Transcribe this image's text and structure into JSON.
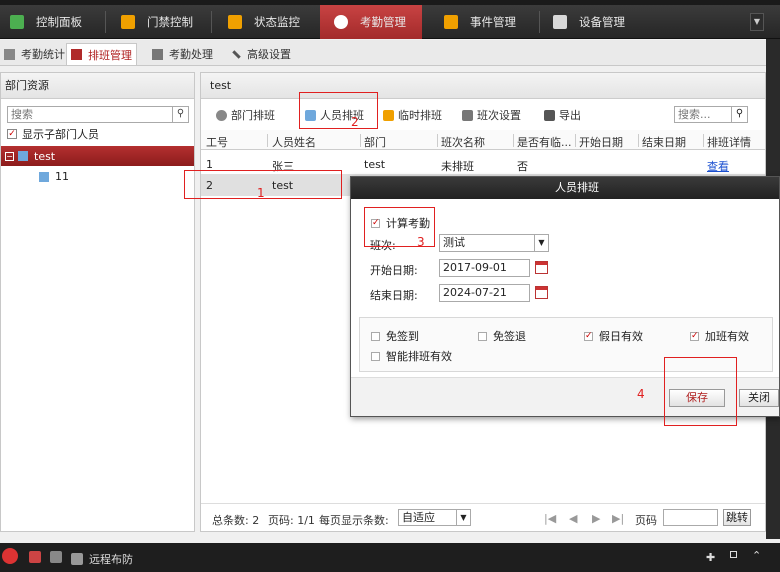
{
  "toolbar": {
    "items": [
      {
        "label": "控制面板",
        "icon": "dashboard-icon",
        "color": "#4caf50"
      },
      {
        "label": "门禁控制",
        "icon": "door-icon",
        "color": "#f0a000"
      },
      {
        "label": "状态监控",
        "icon": "monitor-icon",
        "color": "#f0a000"
      },
      {
        "label": "考勤管理",
        "icon": "attendance-icon",
        "color": "#ffffff"
      },
      {
        "label": "事件管理",
        "icon": "event-icon",
        "color": "#f0a000"
      },
      {
        "label": "设备管理",
        "icon": "device-icon",
        "color": "#e0e0e0"
      }
    ],
    "active_index": 3
  },
  "subtabs": [
    {
      "label": "考勤统计"
    },
    {
      "label": "排班管理"
    },
    {
      "label": "考勤处理"
    },
    {
      "label": "高级设置"
    }
  ],
  "left": {
    "title": "部门资源",
    "search_placeholder": "搜索",
    "show_sub_label": "显示子部门人员",
    "tree_root": "test",
    "tree_child": "11"
  },
  "right": {
    "title": "test",
    "toolbar": {
      "dept_shift": "部门排班",
      "person_shift": "人员排班",
      "temp_shift": "临时排班",
      "shift_settings": "班次设置",
      "export": "导出",
      "search_placeholder": "搜索..."
    },
    "columns": [
      "工号",
      "人员姓名",
      "部门",
      "班次名称",
      "是否有临...",
      "开始日期",
      "结束日期",
      "排班详情"
    ],
    "rows": [
      {
        "id": "1",
        "name": "张三",
        "dept": "test",
        "shift": "未排班",
        "temp": "否",
        "start": "",
        "end": "",
        "detail": "查看"
      },
      {
        "id": "2",
        "name": "test",
        "dept": "",
        "shift": "",
        "temp": "",
        "start": "",
        "end": "",
        "detail": ""
      }
    ],
    "pager": {
      "total": "总条数: 2",
      "page": "页码: 1/1",
      "per_page_label": "每页显示条数:",
      "per_page_value": "自适应",
      "page_label": "页码",
      "go": "跳转"
    }
  },
  "dialog": {
    "title": "人员排班",
    "calc_attendance": "计算考勤",
    "shift_label": "班次:",
    "shift_value": "测试",
    "start_label": "开始日期:",
    "start_value": "2017-09-01",
    "end_label": "结束日期:",
    "end_value": "2024-07-21",
    "opts": {
      "no_signin": "免签到",
      "no_signout": "免签退",
      "holiday_valid": "假日有效",
      "overtime_valid": "加班有效",
      "smart_shift": "智能排班有效"
    },
    "save": "保存",
    "close": "关闭"
  },
  "annotations": [
    "1",
    "2",
    "3",
    "4"
  ],
  "statusbar": {
    "remote_arm": "远程布防"
  },
  "colors": {
    "accent": "#b02a2a",
    "annotation": "#e02020"
  }
}
